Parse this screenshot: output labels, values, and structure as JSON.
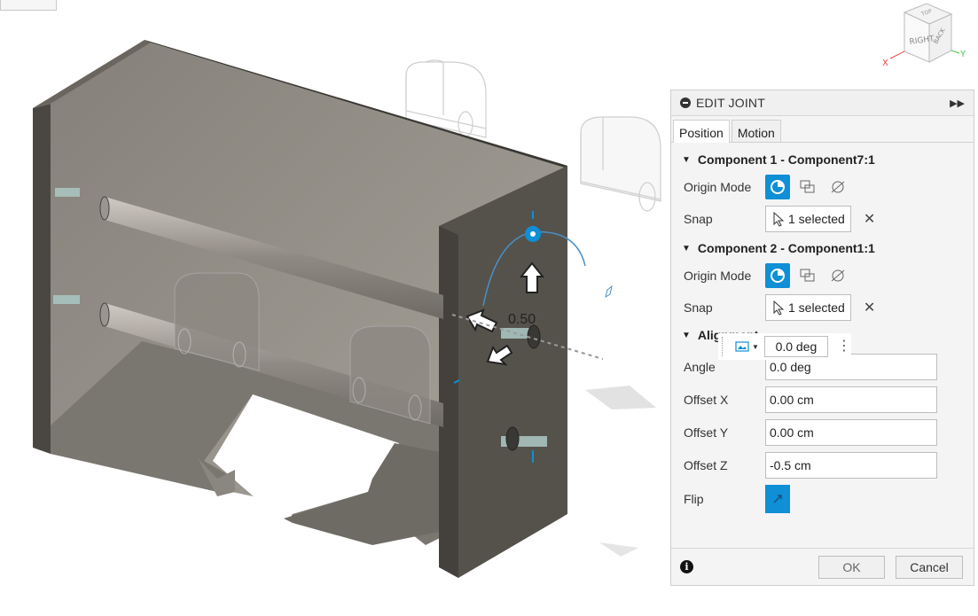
{
  "panel": {
    "title": "EDIT JOINT",
    "tabs": [
      {
        "label": "Position"
      },
      {
        "label": "Motion"
      }
    ],
    "component1": {
      "title": "Component 1 - Component7:1",
      "origin_label": "Origin Mode",
      "snap_label": "Snap",
      "snap_value": "1 selected"
    },
    "component2": {
      "title": "Component 2 - Component1:1",
      "origin_label": "Origin Mode",
      "snap_label": "Snap",
      "snap_value": "1 selected"
    },
    "alignment": {
      "title": "Alignment",
      "angle_label": "Angle",
      "angle_value": "0.0 deg",
      "offset_x_label": "Offset X",
      "offset_x_value": "0.00 cm",
      "offset_y_label": "Offset Y",
      "offset_y_value": "0.00 cm",
      "offset_z_label": "Offset Z",
      "offset_z_value": "-0.5 cm",
      "flip_label": "Flip"
    },
    "footer": {
      "ok": "OK",
      "cancel": "Cancel"
    }
  },
  "mini_toolbar": {
    "value": "0.0 deg"
  },
  "viewport": {
    "angle_readout": "0.50"
  },
  "nav_cube": {
    "face_right": "RIGHT",
    "face_back": "BACK",
    "face_top": "TOP",
    "axis_x": "X",
    "axis_y": "Y"
  },
  "colors": {
    "accent": "#0e8fd6",
    "model": "#5f5b54"
  }
}
